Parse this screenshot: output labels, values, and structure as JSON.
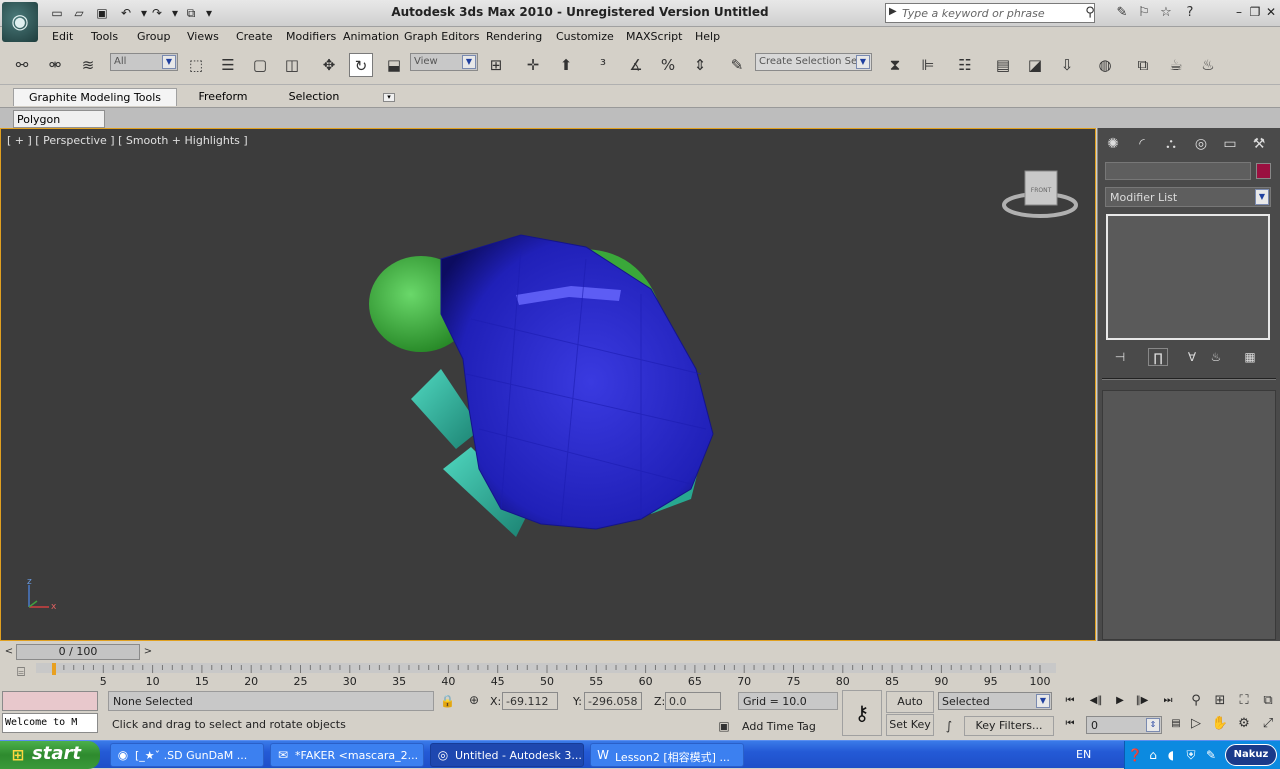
{
  "app": {
    "title": "Autodesk 3ds Max  2010  -  Unregistered Version    Untitled",
    "logo_icon": "3dsmax-logo-icon"
  },
  "search": {
    "placeholder": "Type a keyword or phrase"
  },
  "menu": [
    "Edit",
    "Tools",
    "Group",
    "Views",
    "Create",
    "Modifiers",
    "Animation",
    "Graph Editors",
    "Rendering",
    "Customize",
    "MAXScript",
    "Help"
  ],
  "toolbar": {
    "filter_value": "All",
    "refcoord_value": "View",
    "selection_set_placeholder": "Create Selection Se"
  },
  "ribbon": {
    "tabs": [
      "Graphite Modeling Tools",
      "Freeform",
      "Selection"
    ],
    "subtab": "Polygon Modeling"
  },
  "viewport": {
    "label": "[ + ] [ Perspective ] [ Smooth + Highlights ]",
    "viewcube_face": "FRONT",
    "axis_z": "z",
    "axis_x": "x",
    "colors": {
      "background": "#3c3c3c",
      "shell": "#2020c0",
      "head": "#40c040",
      "legs": "#30b8a0"
    }
  },
  "command_panel": {
    "modifier_list": "Modifier List",
    "object_color": "#9a1040"
  },
  "timeslider": {
    "frame_display": "0 / 100",
    "prev": "<",
    "next": ">"
  },
  "track": {
    "ticks": [
      "5",
      "10",
      "15",
      "20",
      "25",
      "30",
      "35",
      "40",
      "45",
      "50",
      "55",
      "60",
      "65",
      "70",
      "75",
      "80",
      "85",
      "90",
      "95",
      "100"
    ]
  },
  "status": {
    "listener_text": "Welcome to M",
    "selection": "None Selected",
    "prompt": "Click and drag to select and rotate objects",
    "x_label": "X:",
    "x_value": "-69.112",
    "y_label": "Y:",
    "y_value": "-296.058",
    "z_label": "Z:",
    "z_value": "0.0",
    "grid": "Grid = 10.0",
    "add_time_tag": "Add Time Tag",
    "auto_key": "Auto Key",
    "set_key": "Set Key",
    "key_mode": "Selected",
    "key_filters": "Key Filters...",
    "current_frame": "0"
  },
  "taskbar": {
    "start": "start",
    "tasks": [
      {
        "label": "[_★ˇ .SD GunDaM ...",
        "icon": "firefox-icon"
      },
      {
        "label": "*FAKER <mascara_2...",
        "icon": "chat-icon"
      },
      {
        "label": "Untitled - Autodesk 3...",
        "icon": "3dsmax-icon"
      },
      {
        "label": "Lesson2 [相容模式] ...",
        "icon": "word-icon"
      }
    ],
    "language": "EN",
    "tray_badge": "Nakuz"
  }
}
